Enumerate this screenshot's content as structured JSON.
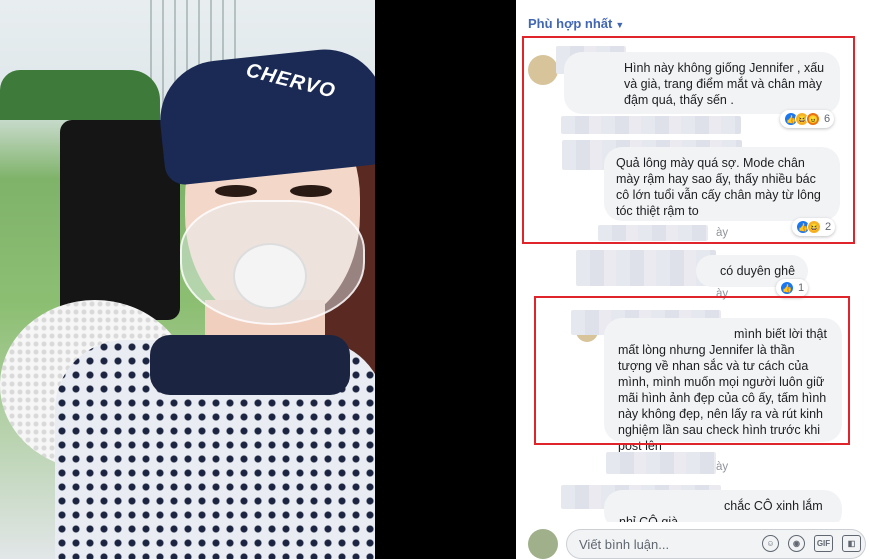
{
  "sort": {
    "label": "Phù hợp nhất"
  },
  "comments": [
    {
      "text": "Hình này không giống Jennifer , xấu và già, trang điểm mắt và chân mày đậm quá, thấy sến .",
      "reaction_count": "6"
    },
    {
      "text": "Quả lông mày quá sợ. Mode chân mày rậm hay sao ấy, thấy nhiều bác cô lớn tuổi vẫn cấy chân mày từ lông tóc thiệt rậm to",
      "reaction_count": "2",
      "time": "ày"
    },
    {
      "text": "có duyên ghê",
      "reaction_count": "1",
      "time": "ày"
    },
    {
      "text": "mình biết lời thật mất lòng nhưng Jennifer là thần tượng về nhan sắc và tư cách của mình, mình muốn mọi người luôn giữ mãi hình ảnh đẹp của cô ấy, tấm hình này không đẹp, nên lấy ra và rút kinh nghiệm lần sau check hình trước khi post lên",
      "time": "ày"
    },
    {
      "text": "chắc CÔ xinh lắm nhỉ CÔ già"
    }
  ],
  "composer": {
    "placeholder": "Viết bình luận..."
  },
  "photo": {
    "hat_brand": "CHERVO"
  },
  "icons": {
    "gif": "GIF"
  }
}
